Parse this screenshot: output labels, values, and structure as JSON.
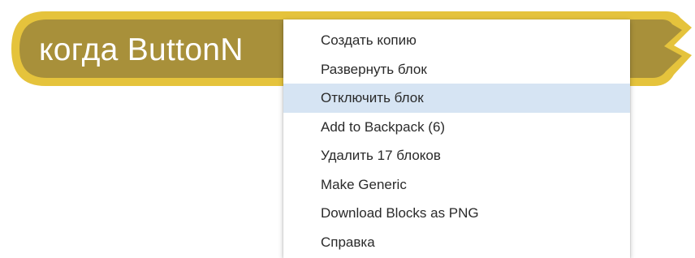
{
  "event_block": {
    "label": "когда ButtonN",
    "fill_color": "#a8903a",
    "border_color": "#e5c33c"
  },
  "context_menu": {
    "highlight_color": "#d6e4f3",
    "items": [
      {
        "label": "Создать копию",
        "highlighted": false
      },
      {
        "label": "Развернуть блок",
        "highlighted": false
      },
      {
        "label": "Отключить блок",
        "highlighted": true
      },
      {
        "label": "Add to Backpack (6)",
        "highlighted": false
      },
      {
        "label": "Удалить 17 блоков",
        "highlighted": false
      },
      {
        "label": "Make Generic",
        "highlighted": false
      },
      {
        "label": "Download Blocks as PNG",
        "highlighted": false
      },
      {
        "label": "Справка",
        "highlighted": false
      }
    ]
  }
}
